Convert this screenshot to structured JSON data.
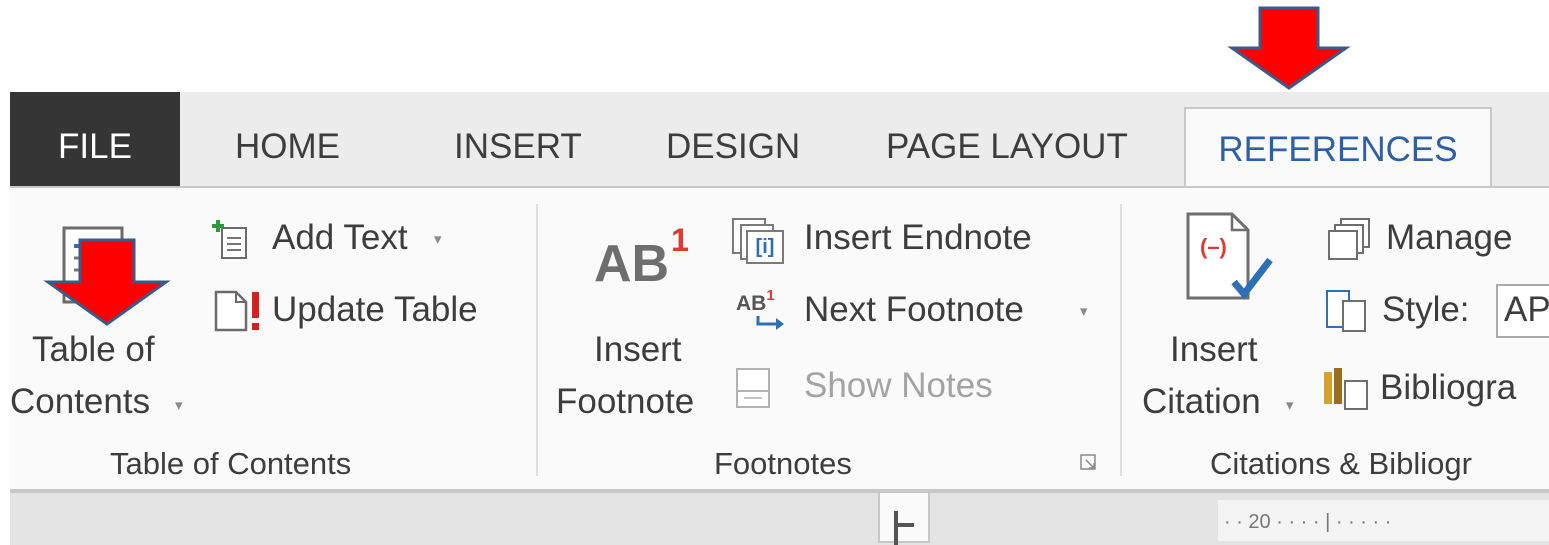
{
  "tabs": {
    "file": "FILE",
    "home": "HOME",
    "insert": "INSERT",
    "design": "DESIGN",
    "page_layout": "PAGE LAYOUT",
    "references": "REFERENCES"
  },
  "groups": {
    "table_of_contents": {
      "label": "Table of Contents",
      "toc_button": {
        "line1": "Table of",
        "line2": "Contents",
        "dropdown": "▾"
      },
      "add_text": {
        "label": "Add Text",
        "dropdown": "▾"
      },
      "update_table": {
        "label": "Update Table"
      }
    },
    "footnotes": {
      "label": "Footnotes",
      "insert_footnote": {
        "line1": "Insert",
        "line2": "Footnote",
        "icon_text": "AB",
        "icon_sup": "1"
      },
      "insert_endnote": {
        "label": "Insert Endnote",
        "icon_text": "[i]"
      },
      "next_footnote": {
        "label": "Next Footnote",
        "icon_text": "AB",
        "icon_sup": "1",
        "dropdown": "▾"
      },
      "show_notes": {
        "label": "Show Notes"
      }
    },
    "citations": {
      "label": "Citations & Bibliogr",
      "insert_citation": {
        "line1": "Insert",
        "line2": "Citation",
        "dropdown": "▾",
        "icon_text": "(–)"
      },
      "manage": {
        "label": "Manage"
      },
      "style": {
        "label": "Style:",
        "value": "AP"
      },
      "bibliography": {
        "label": "Bibliogra"
      }
    }
  },
  "ruler": {
    "marker": "· · 20 · · · · | · · · · ·"
  },
  "colors": {
    "arrow_fill": "#ff0000",
    "arrow_stroke": "#3b5a8a",
    "references_tab_text": "#2f5fa6",
    "file_tab_bg": "#353535"
  }
}
